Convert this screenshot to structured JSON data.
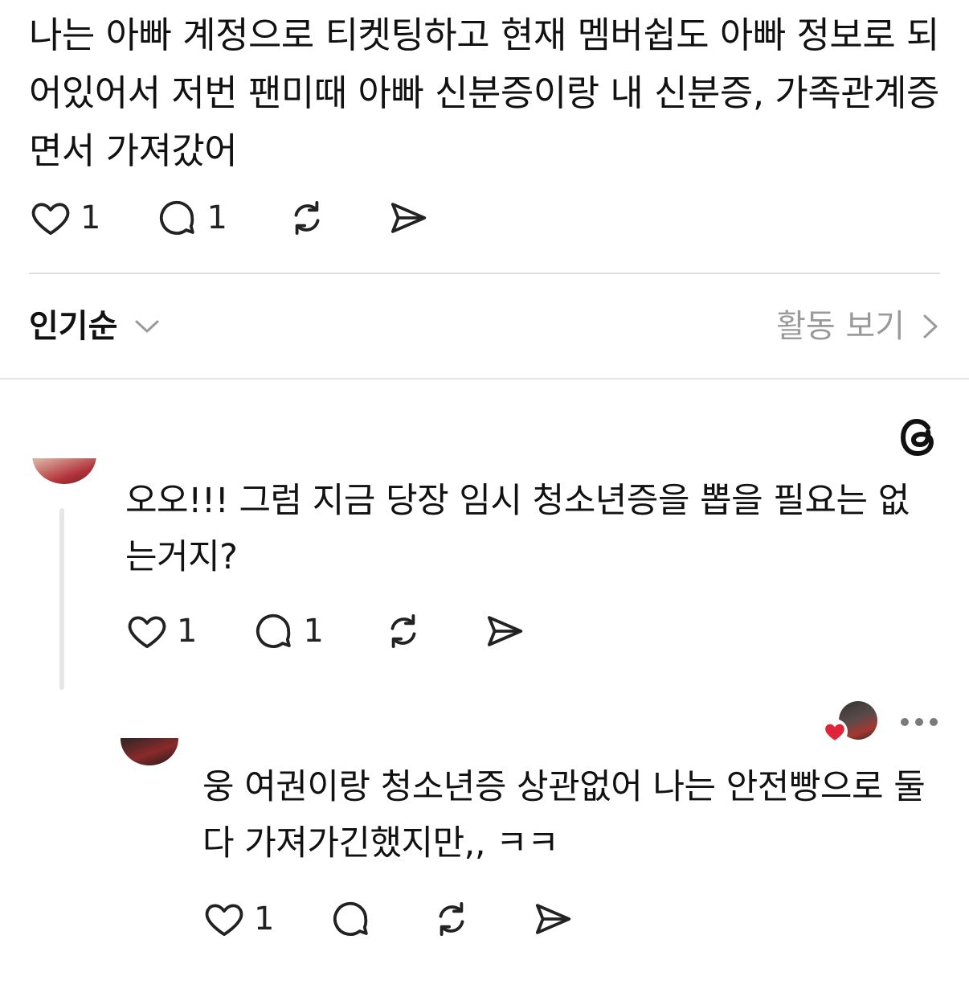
{
  "post": {
    "text": "나는 아빠 계정으로 티켓팅하고 현재 멤버쉽도 아빠 정보로 되어있어서 저번 팬미때 아빠 신분증이랑 내 신분증, 가족관계증면서 가져갔어",
    "likes": "1",
    "replies": "1"
  },
  "sort": {
    "label": "인기순",
    "activity_link": "활동 보기"
  },
  "comments": [
    {
      "text": "오오!!! 그럼 지금 당장 임시 청소년증을 뽑을 필요는 없는거지?",
      "likes": "1",
      "replies": "1"
    },
    {
      "text": "웅 여권이랑 청소년증 상관없어 나는 안전빵으로 둘다 가져가긴했지만,, ㅋㅋ",
      "likes": "1"
    }
  ],
  "icons": {
    "like": "heart-icon",
    "reply": "comment-bubble-icon",
    "repost": "repost-icon",
    "share": "send-icon",
    "brand": "threads-logo-icon",
    "more": "more-dots-icon"
  },
  "colors": {
    "text": "#111111",
    "muted": "#9a9a9a",
    "heart_badge": "#e0243a"
  }
}
